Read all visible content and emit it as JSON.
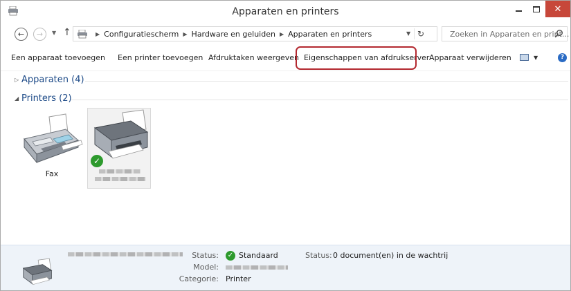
{
  "window": {
    "title": "Apparaten en printers",
    "accent_close": "#c7473a"
  },
  "address": {
    "crumbs": [
      "Configuratiescherm",
      "Hardware en geluiden",
      "Apparaten en printers"
    ],
    "search_placeholder": "Zoeken in Apparaten en print..."
  },
  "toolbar": {
    "add_device": "Een apparaat toevoegen",
    "add_printer": "Een printer toevoegen",
    "print_jobs": "Afdruktaken weergeven",
    "print_server_props": "Eigenschappen van afdrukserver",
    "remove_device": "Apparaat verwijderen",
    "highlight_color": "#b3282f"
  },
  "groups": {
    "devices": {
      "label": "Apparaten (4)",
      "expanded": false
    },
    "printers": {
      "label": "Printers (2)",
      "expanded": true
    }
  },
  "printers": [
    {
      "name": "Fax",
      "icon": "fax-icon",
      "default": false
    },
    {
      "name": "",
      "icon": "printer-icon",
      "default": true
    }
  ],
  "details": {
    "status_label": "Status:",
    "status_value": "Standaard",
    "queue_label": "Status:",
    "queue_value": "0 document(en) in de wachtrij",
    "model_label": "Model:",
    "category_label": "Categorie:",
    "category_value": "Printer"
  }
}
